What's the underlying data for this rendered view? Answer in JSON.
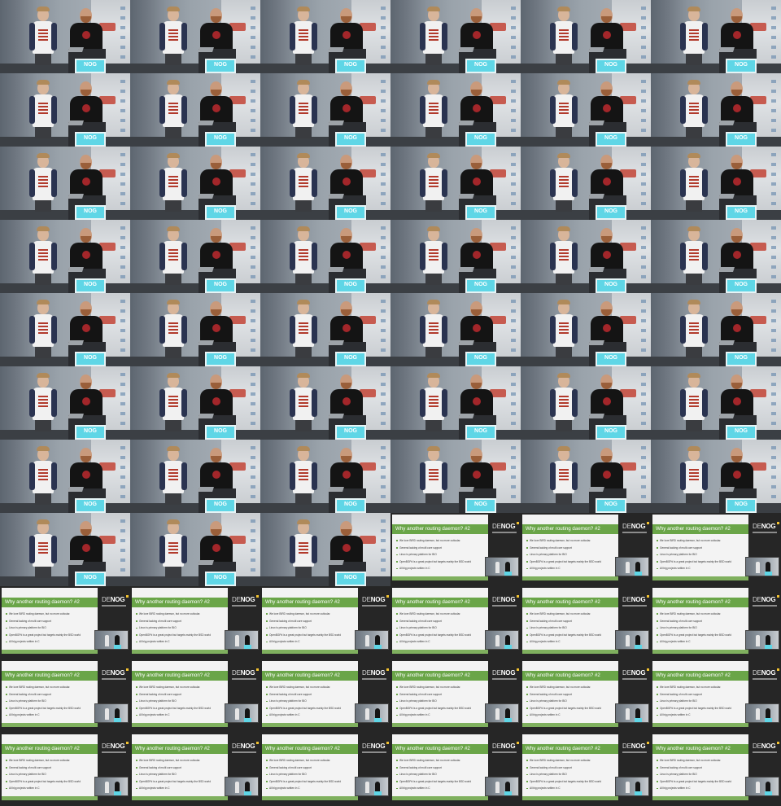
{
  "grid": {
    "columns": 6,
    "rows": 11,
    "stage_frames": 45,
    "slide_frames": 21
  },
  "stage": {
    "monitor_label": "NOG"
  },
  "slide": {
    "title": "Why another routing daemon? #2",
    "bullets": [
      "We love BIRD routing daemon, but no more cuticular.",
      "General lacking of multi core support",
      "Linux is primary platform for BIO",
      "OpenBGPd is a great project but targets mainly the BSD world",
      "All big projects written in C"
    ],
    "brand_prefix": "DE",
    "brand_name": "NOG",
    "colors": {
      "title_bar": "#6aa548",
      "background": "#f3f3f3",
      "frame": "#262626",
      "monitor": "#5fd6e6"
    }
  }
}
